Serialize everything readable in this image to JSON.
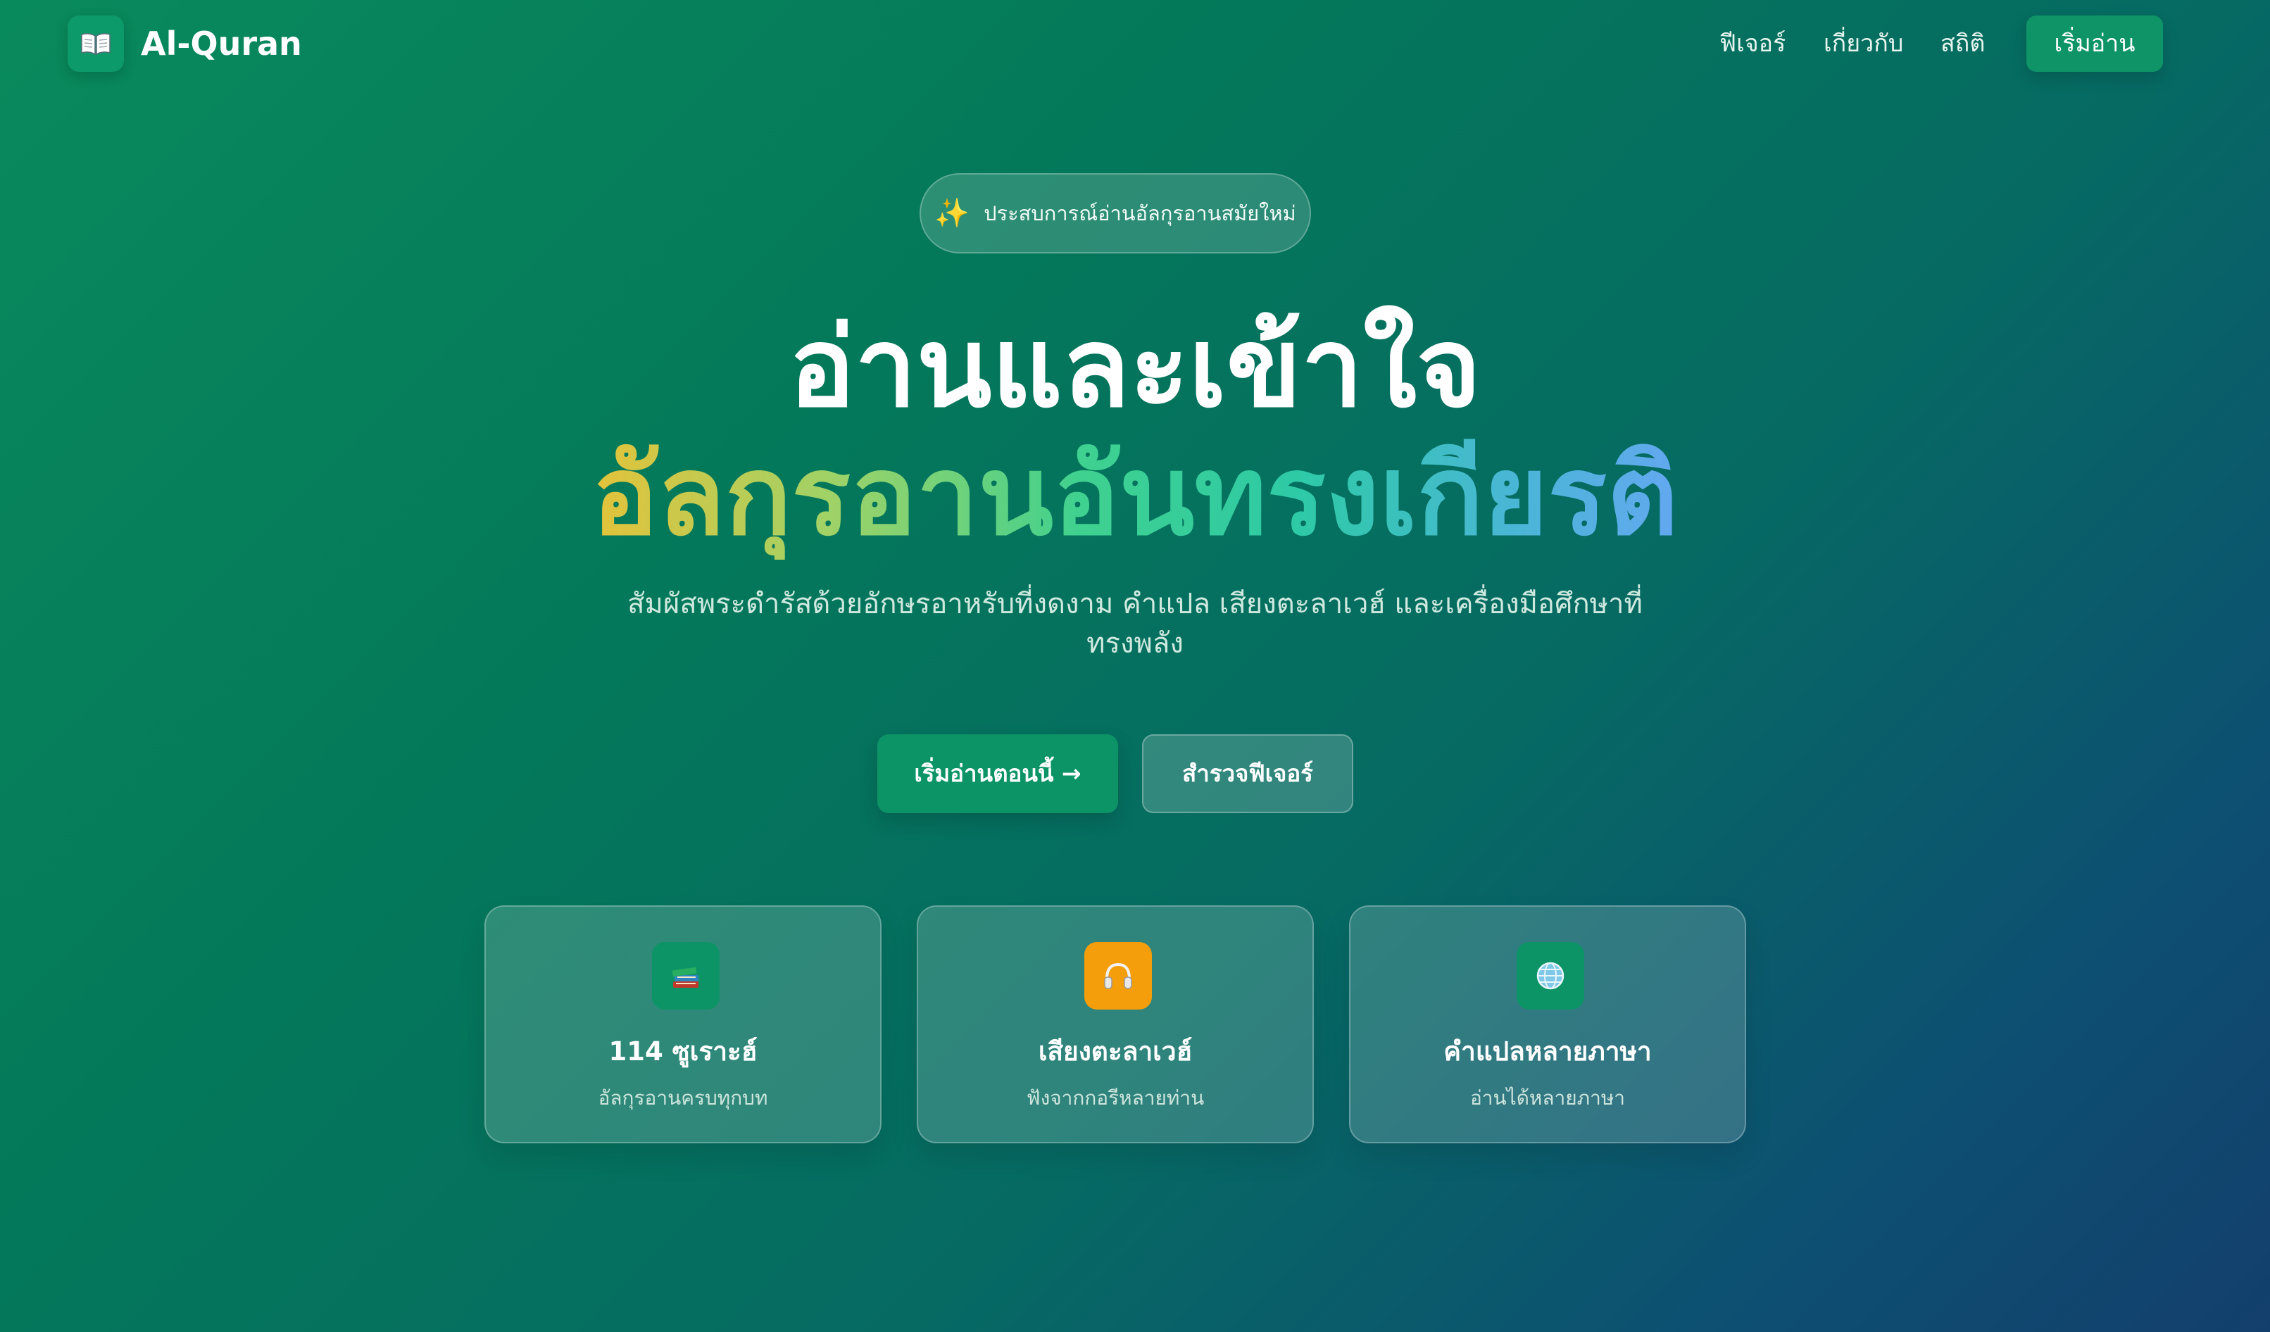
{
  "nav": {
    "logo_icon": "open-book-icon",
    "brand": "Al-Quran",
    "links": [
      "ฟีเจอร์",
      "เกี่ยวกับ",
      "สถิติ"
    ],
    "cta_label": "เริ่มอ่าน"
  },
  "hero": {
    "badge_icon": "sparkles-icon",
    "badge_text": "ประสบการณ์อ่านอัลกุรอานสมัยใหม่",
    "headline_line1": "อ่านและเข้าใจ",
    "headline_line2": "อัลกุรอานอันทรงเกียรติ",
    "subtitle": "สัมผัสพระดำรัสด้วยอักษรอาหรับที่งดงาม คำแปล เสียงตะลาเวฮ์ และเครื่องมือศึกษาที่ทรงพลัง",
    "primary_button": "เริ่มอ่านตอนนี้ →",
    "secondary_button": "สำรวจฟีเจอร์"
  },
  "features": [
    {
      "icon": "books-icon",
      "title": "114 ซูเราะฮ์",
      "subtitle": "อัลกุรอานครบทุกบท",
      "icon_bg": "#0d9466"
    },
    {
      "icon": "headphones-icon",
      "title": "เสียงตะลาเวฮ์",
      "subtitle": "ฟังจากกอรีหลายท่าน",
      "icon_bg": "#f59e0b"
    },
    {
      "icon": "globe-icon",
      "title": "คำแปลหลายภาษา",
      "subtitle": "อ่านได้หลายภาษา",
      "icon_bg": "#0d9466"
    }
  ],
  "colors": {
    "accent_green": "#0d9466",
    "accent_orange": "#f59e0b",
    "gradient_start": "#e4c33a",
    "gradient_end": "#63a8f0"
  }
}
